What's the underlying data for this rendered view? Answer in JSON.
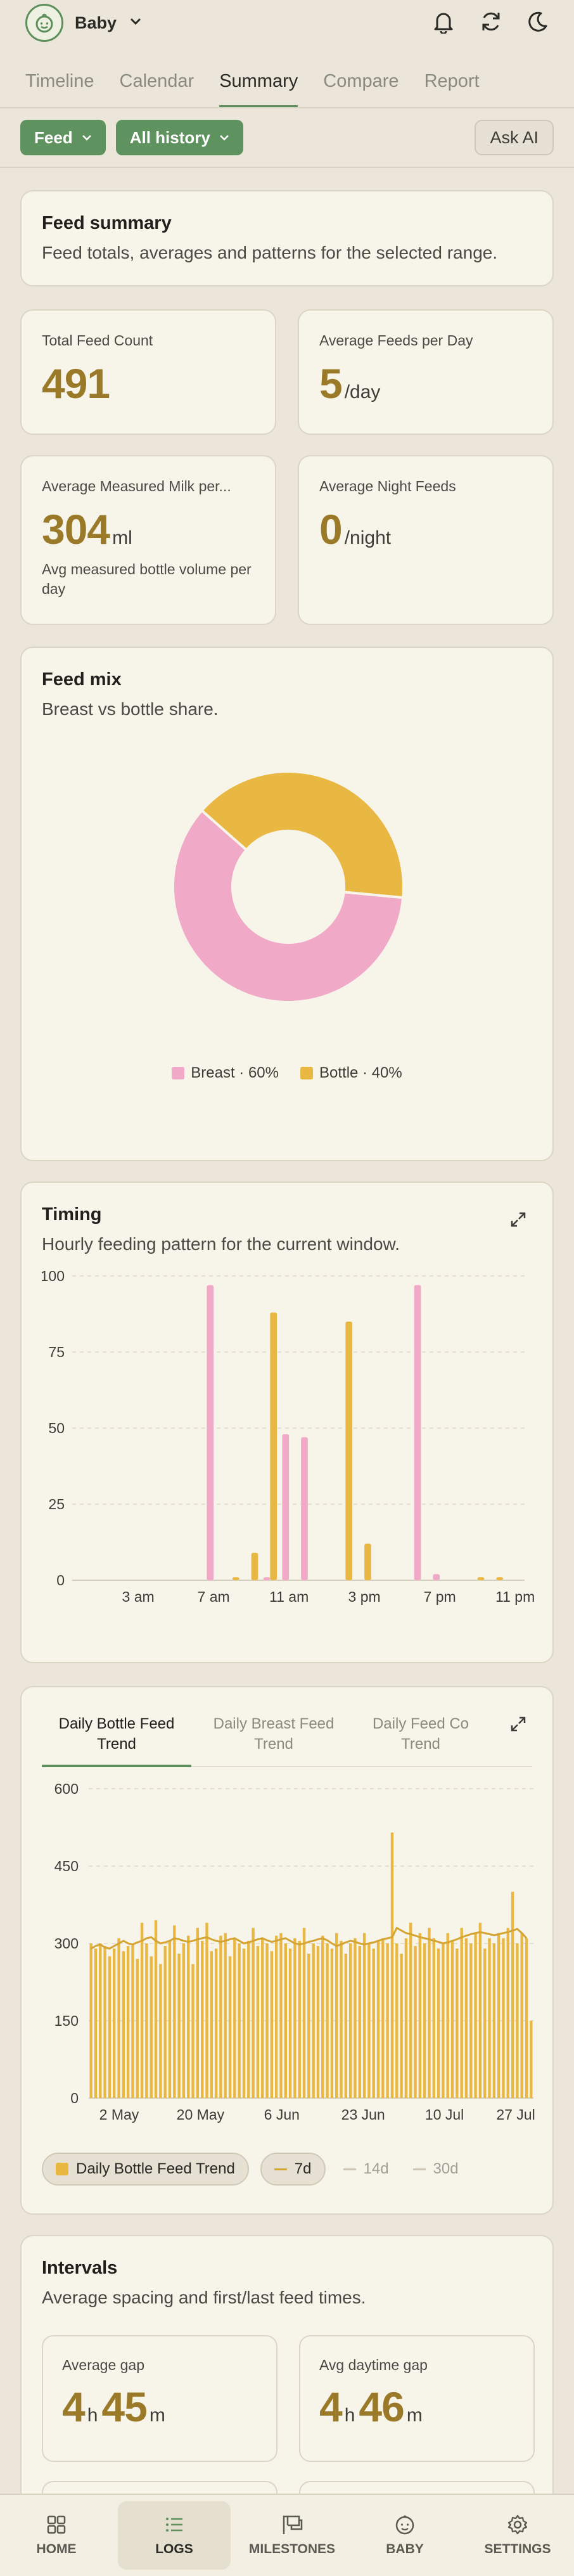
{
  "app": {
    "title": "Baby"
  },
  "tabs": [
    "Timeline",
    "Calendar",
    "Summary",
    "Compare",
    "Report"
  ],
  "filters": {
    "type": "Feed",
    "range": "All history",
    "ask_ai": "Ask AI"
  },
  "summary": {
    "title": "Feed summary",
    "subtitle": "Feed totals, averages and patterns for the selected range."
  },
  "stats": [
    {
      "label": "Total Feed Count",
      "value": "491",
      "unit": ""
    },
    {
      "label": "Average Feeds per Day",
      "value": "5",
      "unit": "/day"
    },
    {
      "label": "Average Measured Milk per...",
      "value": "304",
      "unit": "ml",
      "note": "Avg measured bottle volume per day"
    },
    {
      "label": "Average Night Feeds",
      "value": "0",
      "unit": "/night"
    }
  ],
  "feed_mix": {
    "title": "Feed mix",
    "subtitle": "Breast vs bottle share.",
    "legend": [
      "Breast · 60%",
      "Bottle · 40%"
    ]
  },
  "timing": {
    "title": "Timing",
    "subtitle": "Hourly feeding pattern for the current window."
  },
  "trend": {
    "tabs": [
      "Daily Bottle Feed Trend",
      "Daily Breast Feed Trend",
      "Daily Feed Co Trend"
    ],
    "chips": [
      "Daily Bottle Feed Trend",
      "7d",
      "14d",
      "30d"
    ]
  },
  "intervals": {
    "title": "Intervals",
    "subtitle": "Average spacing and first/last feed times.",
    "avg_gap_label": "Average gap",
    "avg_gap_h": "4",
    "avg_gap_m": "45",
    "day_gap_label": "Avg daytime gap",
    "day_gap_h": "4",
    "day_gap_m": "46",
    "h": "h",
    "m": "m"
  },
  "nav": [
    "HOME",
    "LOGS",
    "MILESTONES",
    "BABY",
    "SETTINGS"
  ],
  "colors": {
    "breast": "#f1a9c8",
    "bottle": "#e9b843",
    "accent": "#5d8f5c"
  },
  "chart_data": [
    {
      "type": "pie",
      "title": "Feed mix",
      "categories": [
        "Breast",
        "Bottle"
      ],
      "values": [
        60,
        40
      ]
    },
    {
      "type": "bar",
      "title": "Timing",
      "x": [
        "12 am",
        "1 am",
        "2 am",
        "3 am",
        "4 am",
        "5 am",
        "6 am",
        "7 am",
        "8 am",
        "9 am",
        "10 am",
        "11 am",
        "12 pm",
        "1 pm",
        "2 pm",
        "3 pm",
        "4 pm",
        "5 pm",
        "6 pm",
        "7 pm",
        "8 pm",
        "9 pm",
        "10 pm",
        "11 pm"
      ],
      "ticks": [
        "3 am",
        "7 am",
        "11 am",
        "3 pm",
        "7 pm",
        "11 pm"
      ],
      "yticks": [
        "0",
        "25",
        "50",
        "75",
        "100"
      ],
      "ylim": [
        0,
        100
      ],
      "series": [
        {
          "name": "Breast",
          "values": [
            0,
            0,
            0,
            0,
            0,
            0,
            0,
            97,
            0,
            0,
            1,
            48,
            47,
            0,
            0,
            0,
            0,
            0,
            97,
            2,
            0,
            0,
            0,
            0
          ]
        },
        {
          "name": "Bottle",
          "values": [
            0,
            0,
            0,
            0,
            0,
            0,
            0,
            0,
            1,
            9,
            88,
            0,
            0,
            0,
            85,
            12,
            0,
            0,
            0,
            0,
            0,
            1,
            1,
            0
          ]
        }
      ]
    },
    {
      "type": "bar",
      "title": "Daily Bottle Feed Trend",
      "yticks": [
        "0",
        "150",
        "300",
        "450",
        "600"
      ],
      "ylim": [
        0,
        600
      ],
      "xticks": [
        "2 May",
        "20 May",
        "6 Jun",
        "23 Jun",
        "10 Jul",
        "27 Jul"
      ],
      "values": [
        300,
        290,
        300,
        295,
        275,
        290,
        310,
        285,
        295,
        300,
        270,
        340,
        300,
        275,
        345,
        260,
        295,
        305,
        335,
        280,
        300,
        315,
        260,
        330,
        305,
        340,
        285,
        290,
        315,
        320,
        275,
        310,
        300,
        290,
        305,
        330,
        295,
        310,
        300,
        285,
        315,
        320,
        300,
        290,
        310,
        305,
        330,
        280,
        300,
        295,
        315,
        300,
        290,
        320,
        305,
        280,
        300,
        310,
        295,
        320,
        300,
        290,
        305,
        310,
        300,
        515,
        300,
        280,
        310,
        340,
        295,
        320,
        300,
        330,
        310,
        290,
        300,
        320,
        305,
        290,
        330,
        310,
        300,
        320,
        340,
        290,
        310,
        300,
        320,
        310,
        330,
        400,
        300,
        320,
        310,
        150
      ],
      "trend7d": [
        290,
        295,
        298,
        292,
        290,
        295,
        300,
        305,
        300,
        298,
        302,
        305,
        310,
        312,
        305,
        300,
        302,
        305,
        310,
        308,
        305,
        303,
        305,
        308,
        310,
        312,
        308,
        305,
        303,
        305,
        308,
        310,
        305,
        300,
        302,
        305,
        308,
        310,
        306,
        303,
        305,
        308,
        310,
        305,
        300,
        298,
        300,
        303,
        305,
        308,
        310,
        306,
        300,
        295,
        298,
        302,
        305,
        303,
        300,
        298,
        300,
        302,
        305,
        308,
        310,
        312,
        330,
        325,
        320,
        318,
        315,
        312,
        310,
        308,
        305,
        303,
        300,
        302,
        305,
        308,
        312,
        315,
        318,
        320,
        322,
        320,
        318,
        316,
        318,
        320,
        322,
        325,
        328,
        320,
        310
      ]
    }
  ]
}
